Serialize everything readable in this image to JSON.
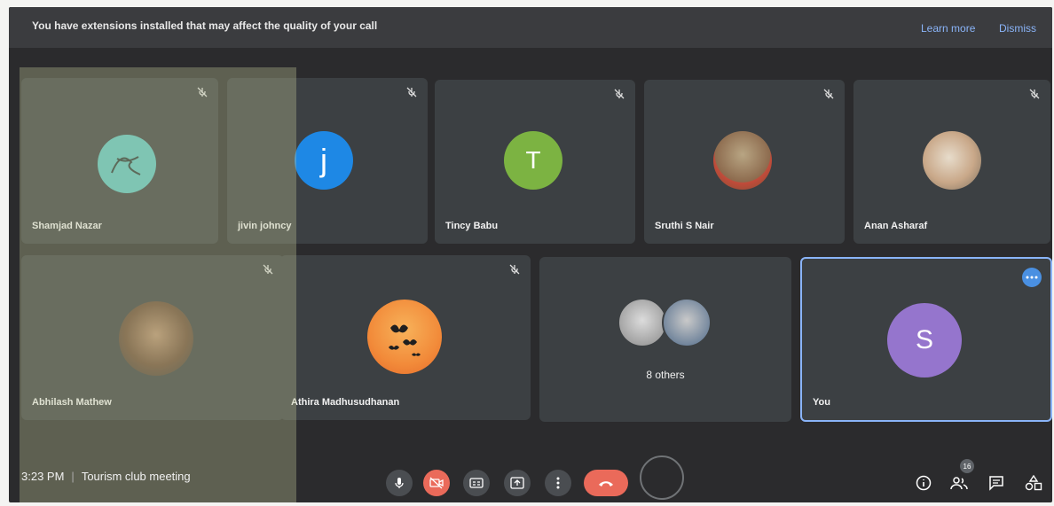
{
  "banner": {
    "message": "You have extensions installed that may affect the quality of your call",
    "learn_more": "Learn more",
    "dismiss": "Dismiss"
  },
  "participants": [
    {
      "name": "Shamjad Nazar",
      "avatar": "photo",
      "muted": true
    },
    {
      "name": "jivin johncy",
      "avatar_letter": "j",
      "color": "#1e88e5",
      "muted": true
    },
    {
      "name": "Tincy Babu",
      "avatar_letter": "T",
      "color": "#7cb342",
      "muted": true
    },
    {
      "name": "Sruthi S Nair",
      "avatar": "photo",
      "muted": true
    },
    {
      "name": "Anan Asharaf",
      "avatar": "photo",
      "muted": true
    },
    {
      "name": "Abhilash Mathew",
      "avatar": "photo",
      "muted": true
    },
    {
      "name": "Athira Madhusudhanan",
      "avatar": "photo",
      "muted": true
    },
    {
      "name": "8 others",
      "avatar": "group"
    },
    {
      "name": "You",
      "avatar_letter": "S",
      "color": "#9575cd",
      "active": true
    }
  ],
  "meeting": {
    "time": "3:23 PM",
    "separator": "|",
    "title": "Tourism club meeting"
  },
  "people_count": "16",
  "colors": {
    "accent": "#8ab4f8",
    "end_call": "#ea6a5a",
    "active_border": "#8ab4f8"
  }
}
